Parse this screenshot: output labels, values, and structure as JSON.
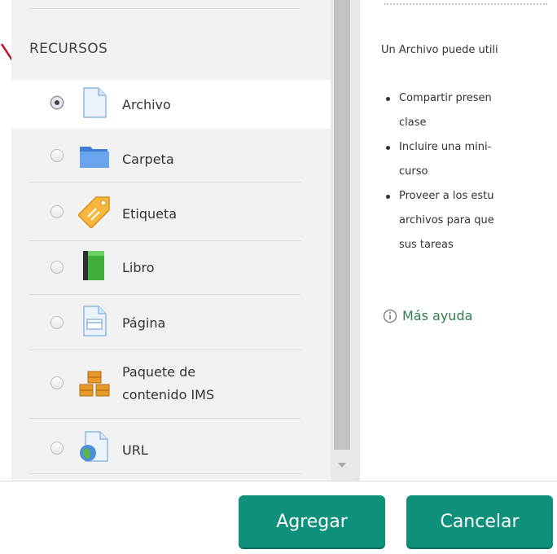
{
  "section": {
    "heading": "RECURSOS"
  },
  "modules": [
    {
      "label": "Archivo",
      "icon": "file-icon",
      "selected": true
    },
    {
      "label": "Carpeta",
      "icon": "folder-icon",
      "selected": false
    },
    {
      "label": "Etiqueta",
      "icon": "label-tag-icon",
      "selected": false
    },
    {
      "label": "Libro",
      "icon": "book-icon",
      "selected": false
    },
    {
      "label": "Página",
      "icon": "page-icon",
      "selected": false
    },
    {
      "label_line1": "Paquete de",
      "label_line2": "contenido IMS",
      "icon": "ims-package-icon",
      "selected": false
    },
    {
      "label": "URL",
      "icon": "url-globe-icon",
      "selected": false
    }
  ],
  "help": {
    "intro": "Un Archivo puede utili",
    "bullets": [
      {
        "line1": "Compartir presen",
        "line2": "clase"
      },
      {
        "line1": "Incluire una mini-",
        "line2": "curso"
      },
      {
        "line1": "Proveer a los estu",
        "line2": "archivos para que",
        "line3": "sus tareas"
      }
    ],
    "more_help": "Más ayuda"
  },
  "buttons": {
    "add": "Agregar",
    "cancel": "Cancelar"
  },
  "colors": {
    "button": "#0f907b",
    "link": "#2f7d4a",
    "arrow": "#c0101a",
    "selected_row": "#ffffff"
  }
}
